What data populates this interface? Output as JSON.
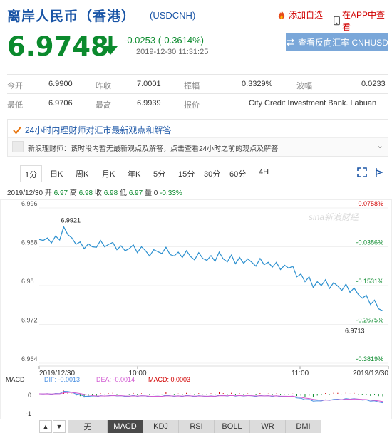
{
  "header": {
    "title": "离岸人民币（香港）",
    "code": "(USDCNH)",
    "fav_label": "添加自选",
    "app_label": "在APP中查看"
  },
  "quote": {
    "price": "6.9748",
    "change": "-0.0253 (-0.3614%)",
    "time": "2019-12-30 11:31:25",
    "reverse_button": "查看反向汇率 CNHUSD"
  },
  "stats": {
    "row1": [
      {
        "label": "今开",
        "value": "6.9900"
      },
      {
        "label": "昨收",
        "value": "7.0001"
      },
      {
        "label": "振幅",
        "value": "0.3329%"
      },
      {
        "label": "波幅",
        "value": "0.0233"
      }
    ],
    "row2": [
      {
        "label": "最低",
        "value": "6.9706"
      },
      {
        "label": "最高",
        "value": "6.9939"
      },
      {
        "label": "报价",
        "value": "City Credit Investment Bank. Labuan"
      }
    ]
  },
  "news": {
    "heading": "24小时内理财师对汇市最新观点和解答",
    "item_text": "新浪理财师：该时段内暂无最新观点及解答，点击查看24小时之前的观点及解答"
  },
  "tabs": [
    "1分",
    "日K",
    "周K",
    "月K",
    "年K",
    "5分",
    "15分",
    "30分",
    "60分",
    "4H"
  ],
  "active_tab": "1分",
  "quote_line": {
    "date": "2019/12/30",
    "open_label": "开",
    "open": "6.97",
    "high_label": "高",
    "high": "6.98",
    "close_label": "收",
    "close": "6.98",
    "low_label": "低",
    "low": "6.97",
    "volume_label": "量",
    "volume": "0",
    "pct": "-0.33%"
  },
  "chart_data": {
    "type": "line",
    "y_ticks": [
      "6.996",
      "6.988",
      "6.98",
      "6.972",
      "6.964"
    ],
    "pct_ticks": [
      "0.0758%",
      "-0.0386%",
      "-0.1531%",
      "-0.2675%",
      "-0.3819%"
    ],
    "x_ticks": [
      "2019/12/30",
      "10:00",
      "11:00",
      "2019/12/30"
    ],
    "ylim": [
      6.964,
      6.996
    ],
    "annotations": {
      "high": "6.9921",
      "low": "6.9713"
    },
    "watermark": "sina新浪财经",
    "values": [
      6.9895,
      6.9893,
      6.9898,
      6.9888,
      6.9902,
      6.9894,
      6.9921,
      6.9905,
      6.9898,
      6.9885,
      6.989,
      6.9876,
      6.9886,
      6.988,
      6.9879,
      6.9893,
      6.988,
      6.9885,
      6.9889,
      6.9874,
      6.9882,
      6.9872,
      6.9876,
      6.9884,
      6.9868,
      6.988,
      6.9872,
      6.9861,
      6.9874,
      6.987,
      6.9866,
      6.9879,
      6.9864,
      6.9861,
      6.9869,
      6.9858,
      6.9872,
      6.986,
      6.9853,
      6.9868,
      6.9856,
      6.9852,
      6.9862,
      6.985,
      6.9869,
      6.9855,
      6.9849,
      6.9863,
      6.9845,
      6.9858,
      6.9846,
      6.9855,
      6.9848,
      6.984,
      6.9856,
      6.9843,
      6.9848,
      6.9838,
      6.9848,
      6.9833,
      6.9842,
      6.9836,
      6.984,
      6.9818,
      6.9824,
      6.9808,
      6.9818,
      6.9796,
      6.9808,
      6.98,
      6.9812,
      6.9794,
      6.9806,
      6.9799,
      6.979,
      6.9803,
      6.9786,
      6.9795,
      6.9782,
      6.9774,
      6.978,
      6.9761,
      6.977,
      6.9752,
      6.9748
    ],
    "macd": {
      "label": "MACD",
      "dif_label": "DIF:",
      "dif": "-0.0013",
      "dea_label": "DEA:",
      "dea": "-0.0014",
      "macd_label": "MACD:",
      "macd_value": "0.0003",
      "y_ticks": [
        "0",
        "-1"
      ]
    }
  },
  "indicators": [
    "无",
    "MACD",
    "KDJ",
    "RSI",
    "BOLL",
    "WR",
    "DMI"
  ],
  "active_indicator": "MACD",
  "colors": {
    "up": "#d10000",
    "down": "#0b8a2d",
    "accent": "#1a55a6",
    "line": "#2a8fcf"
  }
}
